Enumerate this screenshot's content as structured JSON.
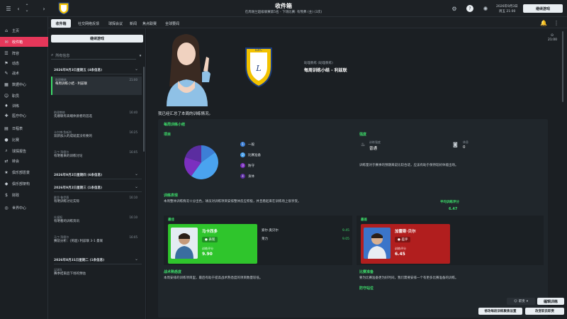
{
  "topbar": {
    "title": "收件箱",
    "subtitle": "在周谢兰超级联赛第5名 - 下场比赛: 有熊弗 (主) (3次)",
    "date": "2026年9月3日",
    "day": "周五 21:00",
    "continue": "继续游戏"
  },
  "sidebar": {
    "items": [
      {
        "label": "主页",
        "icon": "⌂"
      },
      {
        "label": "收件箱",
        "icon": "✉"
      },
      {
        "label": "阵容",
        "icon": "☰"
      },
      {
        "label": "动态",
        "icon": "⚑"
      },
      {
        "label": "战术",
        "icon": "✎"
      },
      {
        "label": "数据中心",
        "icon": "▦"
      },
      {
        "label": "职员",
        "icon": "☺"
      },
      {
        "label": "训练",
        "icon": "♦"
      },
      {
        "label": "医疗中心",
        "icon": "✚"
      },
      {
        "label": "日程表",
        "icon": "▤"
      },
      {
        "label": "比赛",
        "icon": "●"
      },
      {
        "label": "球探报告",
        "icon": "⌕"
      },
      {
        "label": "转会",
        "icon": "⇄"
      },
      {
        "label": "俱乐部愿景",
        "icon": "★"
      },
      {
        "label": "俱乐部架构",
        "icon": "◆"
      },
      {
        "label": "财政",
        "icon": "$"
      },
      {
        "label": "世界中心",
        "icon": "◎"
      }
    ],
    "active": 1
  },
  "tabs": {
    "items": [
      "收件箱",
      "社交网络反馈",
      "球探会议",
      "新闻",
      "焦点联赛",
      "全球要闻"
    ]
  },
  "inbox": {
    "continue_btn": "继续游戏",
    "search_placeholder": "所有信息",
    "groups": [
      {
        "date": "2026年9月3日星期五 (4条信息)",
        "msgs": [
          {
            "sender": "助理教练",
            "text": "每周训练小结 - 利兹联",
            "time": "21:00",
            "selected": true
          },
          {
            "sender": "助理教练",
            "text": "先顺联有高端体质者的首选",
            "time": "16:40"
          },
          {
            "sender": "卡尔博·鱼新利",
            "text": "双新加入的成就度没有要的",
            "time": "16:25"
          },
          {
            "sender": "马丁·拜德尔",
            "text": "有明看来的训练讨论",
            "time": "16:05"
          }
        ]
      },
      {
        "date": "2026年9月2日星期四 (6条信息)",
        "msgs": []
      },
      {
        "date": "2026年9月2日星期三 (1条信息)",
        "msgs": [
          {
            "sender": "戴里·鲁伊赛",
            "text": "有明训练讨论实际",
            "time": "16:10"
          },
          {
            "sender": "社媒报",
            "text": "有明看的训练资讯",
            "time": "16:10"
          },
          {
            "sender": "马丁·拜德尔",
            "text": "赛前分析：(英超) 利兹联 3-1 曼联",
            "time": "16:05"
          }
        ]
      },
      {
        "date": "2026年8月31日星期二 (1条信息)",
        "msgs": [
          {
            "sender": "足球队",
            "text": "赛季结束后下场的预估",
            "time": ""
          }
        ]
      }
    ]
  },
  "email": {
    "from_role": "助理教练 (助理教练)",
    "from_name": "每周训练小结 - 利兹联",
    "time": "21:00",
    "intro": "我已经汇总了本周的训练情况。",
    "section_title": "每周训练小结",
    "project_label": "项目",
    "legend": [
      "一般",
      "比赛准备",
      "防守",
      "身体"
    ],
    "intensity_label": "强度",
    "intensity_sub": "训练强度",
    "intensity_value": "普通",
    "rest_label": "休息",
    "rest_value": "0",
    "intensity_text": "训练量对于赛季的预期来说比较合适，应该有助于保持较好体能出场。",
    "perf_label": "训练表现",
    "perf_text": "本周整体训练情况十分出色，球员对训练项目安排整体反应积极，并且看起来在训练场上很享受。",
    "avg_label": "平均训练评分",
    "avg_value": "6.47",
    "best_label": "最佳",
    "best": {
      "name": "马卡西多",
      "role": "表现",
      "sub": "训练评分",
      "score": "9.90"
    },
    "others": [
      {
        "name": "索尔·奥贝尔",
        "score": "9.45"
      },
      {
        "name": "莱力",
        "score": "9.05"
      }
    ],
    "worst_label": "最差",
    "worst": {
      "name": "加雷斯·贝尔",
      "role": "差评",
      "sub": "训练评分",
      "score": "6.45"
    },
    "tactic_label": "战术熟悉度",
    "tactic_text": "本周安排的训练项目里，最后有助于提高战术熟悉度的项目数量较低。",
    "match_label": "比赛准备",
    "match_text": "要为比赛准备更为好时间，我们需要安排一个有更多比赛准备的训练。",
    "defend_label": "防守站位"
  },
  "footer": {
    "staff": "职责",
    "edit_btn": "编辑训练",
    "btn1": "修改每段训练聚焦设置",
    "btn2": "改变职员职责"
  },
  "chart_data": {
    "type": "pie",
    "categories": [
      "一般",
      "比赛准备",
      "防守",
      "身体"
    ],
    "values": [
      15,
      45,
      20,
      20
    ],
    "colors": [
      "#3d7fd6",
      "#4aa3ef",
      "#7b2fbf",
      "#5b2da0"
    ]
  }
}
